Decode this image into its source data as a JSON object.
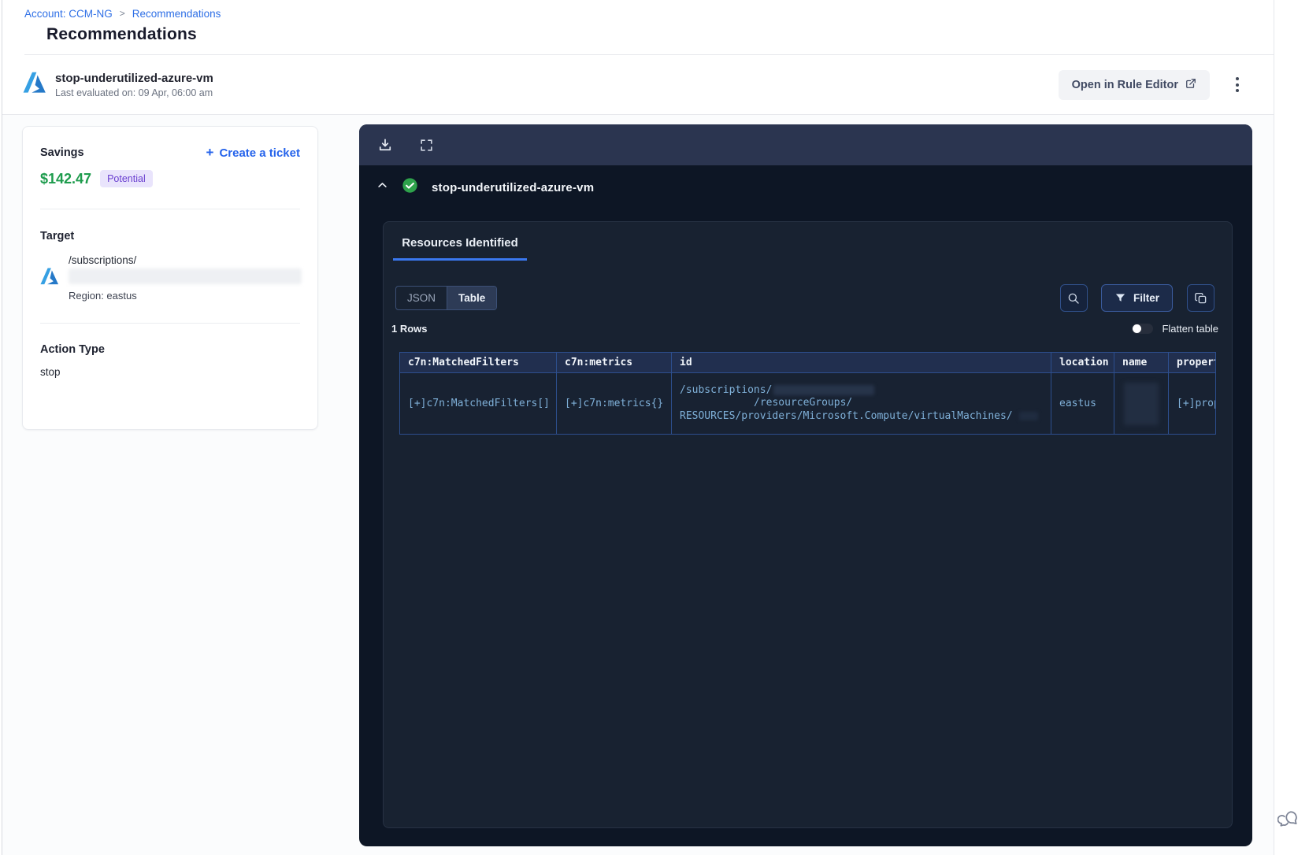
{
  "breadcrumb": {
    "account": "Account: CCM-NG",
    "separator": ">",
    "current": "Recommendations"
  },
  "page_title": "Recommendations",
  "rule_header": {
    "name": "stop-underutilized-azure-vm",
    "last_evaluated": "Last evaluated on: 09 Apr, 06:00 am",
    "open_in_rule_editor": "Open in Rule Editor"
  },
  "details_card": {
    "savings_label": "Savings",
    "plus_sign": "+",
    "create_ticket_label": "Create a ticket",
    "savings_amount": "$142.47",
    "savings_badge": "Potential",
    "target_label": "Target",
    "target_path": "/subscriptions/",
    "target_region": "Region: eastus",
    "action_type_label": "Action Type",
    "action_type_value": "stop"
  },
  "panel": {
    "rule_name": "stop-underutilized-azure-vm",
    "tab_label": "Resources Identified",
    "view_toggle": {
      "json": "JSON",
      "table": "Table"
    },
    "filter_label": "Filter",
    "rows_count": "1 Rows",
    "flatten_label": "Flatten table",
    "table": {
      "columns": [
        "c7n:MatchedFilters",
        "c7n:metrics",
        "id",
        "location",
        "name",
        "propert"
      ],
      "row": {
        "matched_filters": "[+]c7n:MatchedFilters[]",
        "metrics": "[+]c7n:metrics{}",
        "id_line1": "/subscriptions/",
        "id_line2": "/resourceGroups/",
        "id_line3": "RESOURCES/providers/Microsoft.Compute/virtualMachines/",
        "location": "eastus",
        "properties": "[+]prop"
      }
    }
  },
  "icons": [
    "azure-logo-icon",
    "breadcrumb-chevron-icon",
    "external-link-icon",
    "kebab-menu-icon",
    "download-icon",
    "fullscreen-icon",
    "chevron-up-icon",
    "check-circle-icon",
    "search-icon",
    "filter-funnel-icon",
    "copy-icon",
    "toggle-off",
    "plus-icon",
    "chat-support-icon"
  ],
  "colors": {
    "link_blue": "#2e6fe6",
    "savings_green": "#1e9c4d",
    "badge_bg": "#e9e4fc",
    "badge_text": "#6a3fd0",
    "tab_underline": "#3a78ef",
    "panel_bg": "#0d1625",
    "toolbar_bg": "#2b3550",
    "inner_card_bg": "#182231",
    "table_border": "#2d4f8e",
    "table_header_bg": "#212f4f",
    "cell_link_blue": "#7fb0d8",
    "check_green": "#2ea24b",
    "azure_blue": "#2e8ae0"
  }
}
